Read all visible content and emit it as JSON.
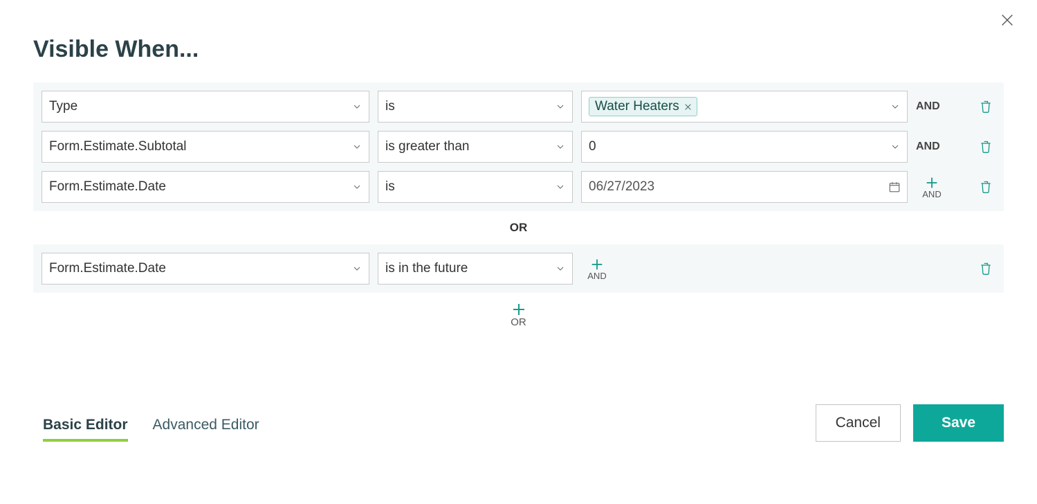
{
  "title": "Visible When...",
  "labels": {
    "and": "AND",
    "or_sep": "OR",
    "add_and": "AND",
    "add_or": "OR"
  },
  "groups": [
    {
      "rows": [
        {
          "field": "Type",
          "operator": "is",
          "value_type": "tag",
          "value": "Water Heaters",
          "joiner": "and"
        },
        {
          "field": "Form.Estimate.Subtotal",
          "operator": "is greater than",
          "value_type": "text",
          "value": "0",
          "joiner": "and"
        },
        {
          "field": "Form.Estimate.Date",
          "operator": "is",
          "value_type": "date",
          "value": "06/27/2023",
          "joiner": "add"
        }
      ]
    },
    {
      "rows": [
        {
          "field": "Form.Estimate.Date",
          "operator": "is in the future",
          "value_type": "none",
          "value": "",
          "joiner": "add"
        }
      ]
    }
  ],
  "tabs": {
    "basic": "Basic Editor",
    "advanced": "Advanced Editor"
  },
  "buttons": {
    "cancel": "Cancel",
    "save": "Save"
  }
}
